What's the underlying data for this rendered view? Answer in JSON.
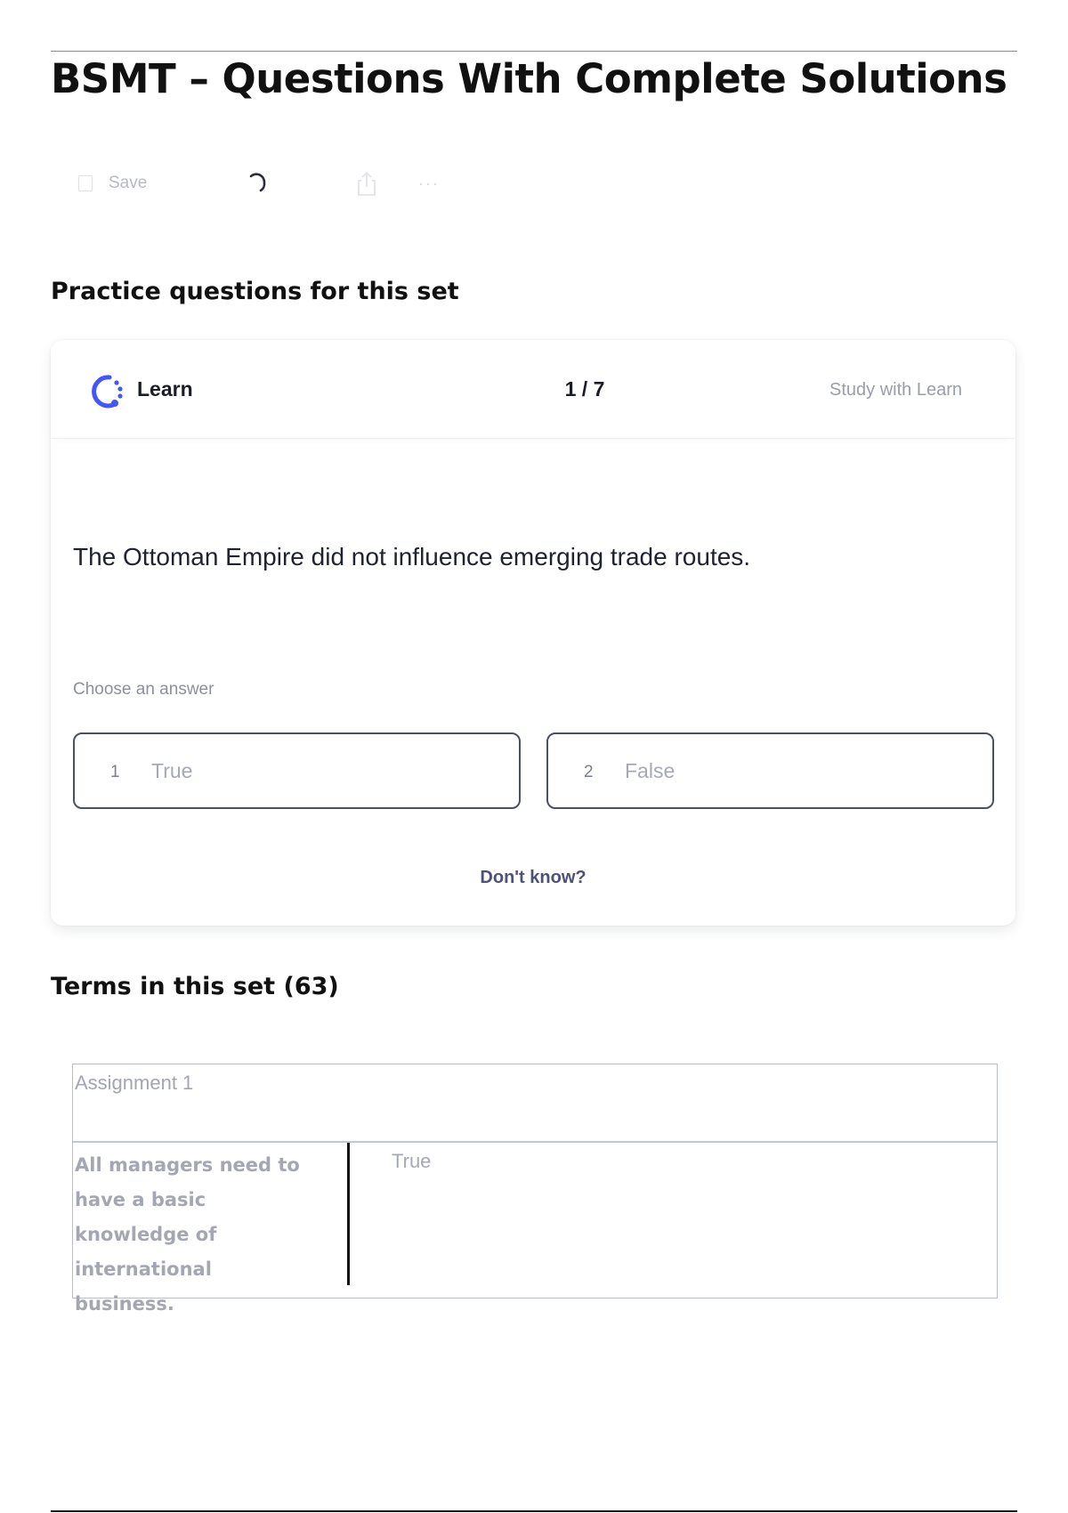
{
  "page": {
    "title": "BSMT – Questions With Complete Solutions"
  },
  "toolbar": {
    "save_label": "Save",
    "icons": [
      "bookmark-icon",
      "loading-spinner-icon",
      "share-icon",
      "more-icon"
    ],
    "more_glyph": "···"
  },
  "practice": {
    "heading": "Practice questions for this set",
    "learn_label": "Learn",
    "progress": "1 / 7",
    "study_link": "Study with Learn",
    "question": "The Ottoman Empire did not influence emerging trade routes.",
    "prompt": "Choose an answer",
    "answers": [
      {
        "number": "1",
        "label": "True"
      },
      {
        "number": "2",
        "label": "False"
      }
    ],
    "dont_know": "Don't know?",
    "accent_color": "#4255ff"
  },
  "terms": {
    "heading": "Terms in this set (63)",
    "group_title": "Assignment 1",
    "rows": [
      {
        "term": "All managers need to have a basic knowledge of international business.",
        "definition": "True"
      }
    ]
  }
}
